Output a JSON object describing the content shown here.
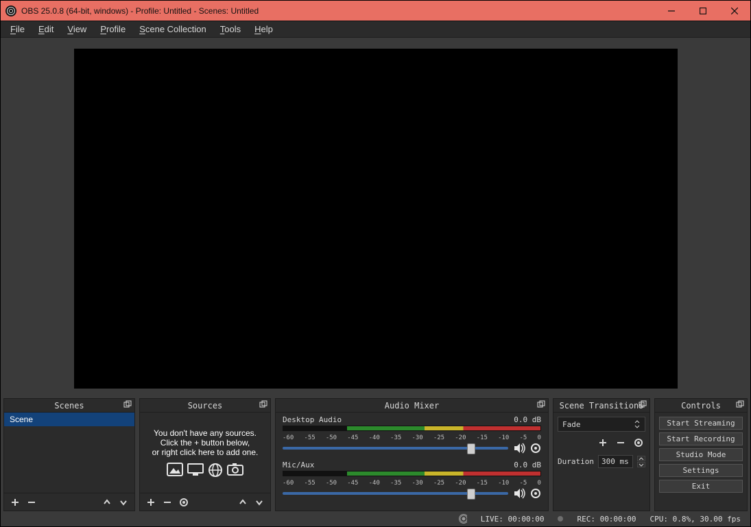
{
  "titlebar": {
    "title": "OBS 25.0.8 (64-bit, windows) - Profile: Untitled - Scenes: Untitled"
  },
  "menus": [
    "File",
    "Edit",
    "View",
    "Profile",
    "Scene Collection",
    "Tools",
    "Help"
  ],
  "docks": {
    "scenes": {
      "title": "Scenes"
    },
    "sources": {
      "title": "Sources"
    },
    "audio": {
      "title": "Audio Mixer"
    },
    "transitions": {
      "title": "Scene Transitions"
    },
    "controls": {
      "title": "Controls"
    }
  },
  "scenes": {
    "items": [
      {
        "label": "Scene",
        "selected": true
      }
    ]
  },
  "sources": {
    "hint_line1": "You don't have any sources.",
    "hint_line2": "Click the + button below,",
    "hint_line3": "or right click here to add one."
  },
  "audio": {
    "ticks": [
      "-60",
      "-55",
      "-50",
      "-45",
      "-40",
      "-35",
      "-30",
      "-25",
      "-20",
      "-15",
      "-10",
      "-5",
      "0"
    ],
    "tracks": [
      {
        "name": "Desktop Audio",
        "level": "0.0 dB"
      },
      {
        "name": "Mic/Aux",
        "level": "0.0 dB"
      }
    ]
  },
  "transitions": {
    "selected": "Fade",
    "duration_label": "Duration",
    "duration_value": "300 ms"
  },
  "controls": {
    "start_streaming": "Start Streaming",
    "start_recording": "Start Recording",
    "studio_mode": "Studio Mode",
    "settings": "Settings",
    "exit": "Exit"
  },
  "status": {
    "live": "LIVE: 00:00:00",
    "rec": "REC: 00:00:00",
    "cpu": "CPU: 0.8%, 30.00 fps"
  }
}
